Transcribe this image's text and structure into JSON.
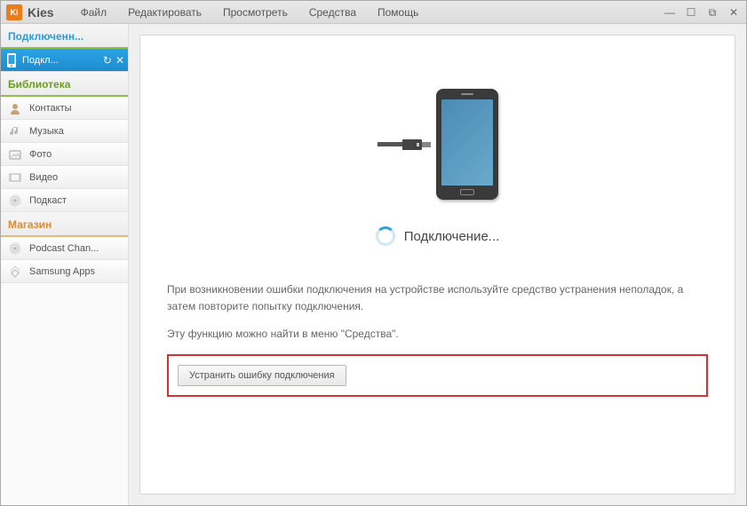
{
  "app": {
    "icon_text": "Ki",
    "title": "Kies"
  },
  "menu": {
    "file": "Файл",
    "edit": "Редактировать",
    "view": "Просмотреть",
    "tools": "Средства",
    "help": "Помощь"
  },
  "win": {
    "min": "—",
    "max": "☐",
    "restore": "⧉",
    "close": "✕"
  },
  "sidebar": {
    "connected_header": "Подключенн...",
    "active": {
      "label": "Подкл..."
    },
    "library_header": "Библиотека",
    "library": [
      {
        "label": "Контакты"
      },
      {
        "label": "Музыка"
      },
      {
        "label": "Фото"
      },
      {
        "label": "Видео"
      },
      {
        "label": "Подкаст"
      }
    ],
    "store_header": "Магазин",
    "store": [
      {
        "label": "Podcast Chan..."
      },
      {
        "label": "Samsung Apps"
      }
    ]
  },
  "main": {
    "status": "Подключение...",
    "help1": "При возникновении ошибки подключения на устройстве используйте средство устранения неполадок, а затем повторите попытку подключения.",
    "help2": "Эту функцию можно найти в меню \"Средства\".",
    "fix_btn": "Устранить ошибку подключения"
  }
}
